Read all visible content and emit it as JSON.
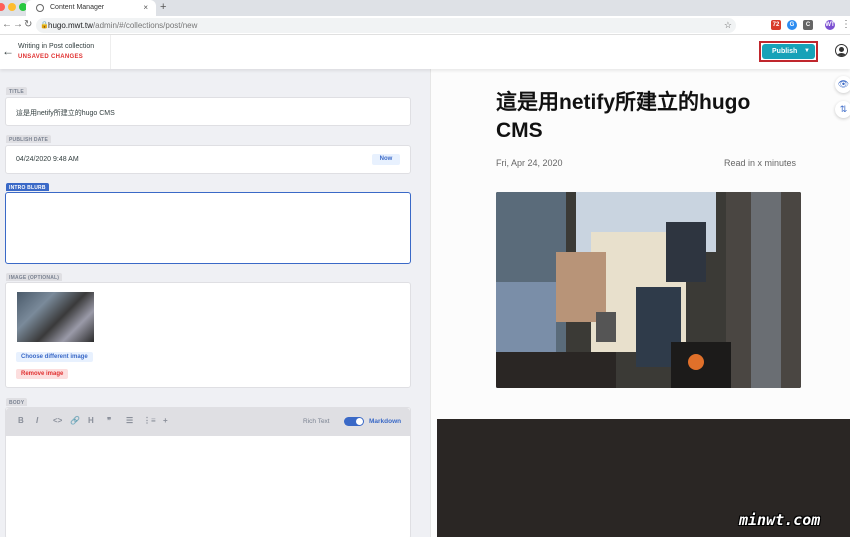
{
  "browser": {
    "tab_title": "Content Manager",
    "tab_close": "×",
    "new_tab": "+",
    "url_host": "hugo.mwt.tw",
    "url_path": "/admin/#/collections/post/new",
    "back": "←",
    "forward": "→",
    "reload": "↻",
    "lock": "🔒",
    "bookmark": "☆",
    "extensions": [
      {
        "label": "72",
        "color": "#d83b2b"
      },
      {
        "label": "G",
        "color": "#2d8cf0"
      },
      {
        "label": "C",
        "color": "#666666"
      },
      {
        "label": "▣",
        "color": "#888888"
      },
      {
        "label": "WT",
        "color": "#7b4fd1"
      }
    ],
    "menu": "⋮"
  },
  "header": {
    "back_arrow": "←",
    "collection_label": "Writing in Post collection",
    "status": "UNSAVED CHANGES",
    "publish_label": "Publish",
    "publish_caret": "▼",
    "accent": "#17a2b8"
  },
  "editor": {
    "title_label": "TITLE",
    "title_value": "這是用netify所建立的hugo CMS",
    "date_label": "PUBLISH DATE",
    "date_value": "04/24/2020 9:48 AM",
    "now_label": "Now",
    "intro_label": "INTRO BLURB",
    "intro_value": "",
    "image_label": "IMAGE (OPTIONAL)",
    "choose_label": "Choose different image",
    "remove_label": "Remove image",
    "body_label": "BODY",
    "toolbar_icons": [
      "B",
      "I",
      "<>",
      "🔗",
      "H",
      "❞",
      "☰",
      "⋮≡",
      "+"
    ],
    "rich_text_label": "Rich Text",
    "markdown_label": "Markdown"
  },
  "preview": {
    "title": "這是用netify所建立的hugo CMS",
    "date": "Fri, Apr 24, 2020",
    "read_time": "Read in x minutes",
    "eye_icon": "👁",
    "scroll_icon": "⇅"
  },
  "watermark": "minwt.com"
}
